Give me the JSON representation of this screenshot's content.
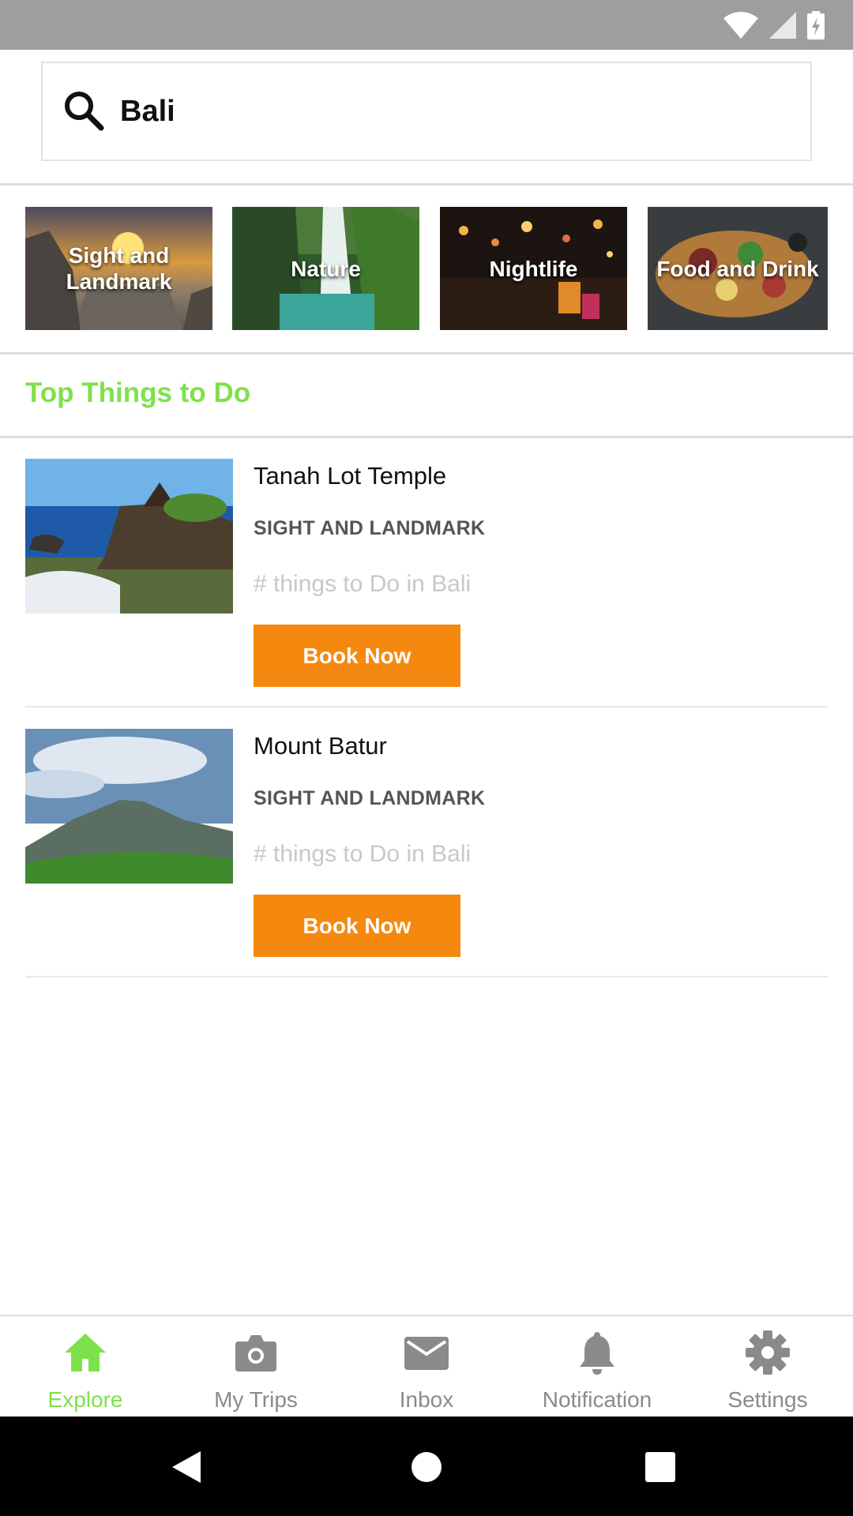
{
  "search": {
    "query": "Bali"
  },
  "categories": [
    {
      "label": "Sight and Landmark"
    },
    {
      "label": "Nature"
    },
    {
      "label": "Nightlife"
    },
    {
      "label": "Food and Drink"
    }
  ],
  "section": {
    "title": "Top Things to Do"
  },
  "items": [
    {
      "title": "Tanah Lot Temple",
      "category": "SIGHT AND LANDMARK",
      "meta": "# things to Do in Bali",
      "button": "Book Now"
    },
    {
      "title": "Mount Batur",
      "category": "SIGHT AND LANDMARK",
      "meta": "# things to Do in Bali",
      "button": "Book Now"
    }
  ],
  "nav": {
    "items": [
      {
        "label": "Explore",
        "icon": "home-icon",
        "active": true
      },
      {
        "label": "My Trips",
        "icon": "camera-icon"
      },
      {
        "label": "Inbox",
        "icon": "mail-icon"
      },
      {
        "label": "Notification",
        "icon": "bell-icon"
      },
      {
        "label": "Settings",
        "icon": "gear-icon"
      }
    ]
  },
  "colors": {
    "accent": "#7ee14a",
    "button": "#f5890f",
    "status_bar": "#9e9e9e",
    "nav_inactive": "#8a8a8a"
  }
}
